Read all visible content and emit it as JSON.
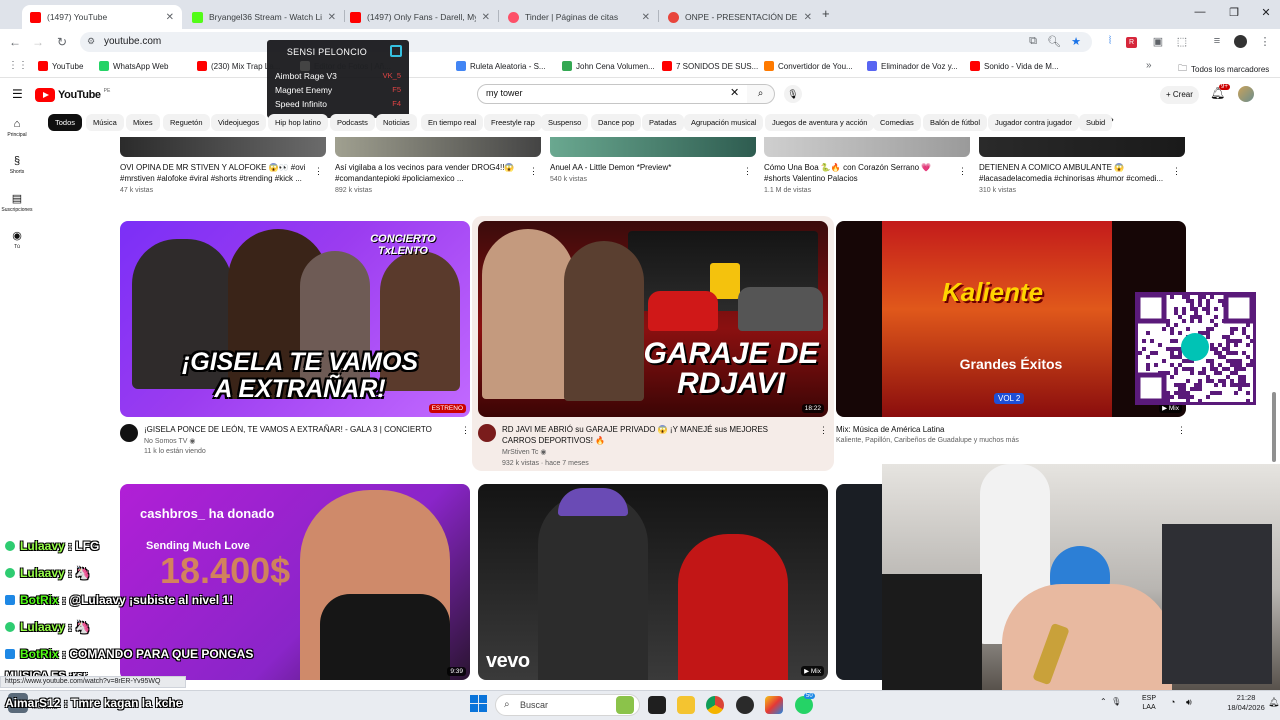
{
  "browser": {
    "tabs": [
      {
        "title": "(1497) YouTube",
        "active": true,
        "color": "#ff0000"
      },
      {
        "title": "Bryangel36 Stream - Watch Live",
        "active": false,
        "color": "#53fc18"
      },
      {
        "title": "(1497) Only Fans - Darell, Myke",
        "active": false,
        "color": "#ff0000"
      },
      {
        "title": "Tinder | Páginas de citas",
        "active": false,
        "color": "#fd5068"
      },
      {
        "title": "ONPE - PRESENTACIÓN DE RESU",
        "active": false,
        "color": "#e8453c"
      }
    ],
    "new_tab": "+",
    "url": "youtube.com",
    "bookmarks": [
      {
        "label": "YouTube",
        "color": "#ff0000"
      },
      {
        "label": "WhatsApp Web",
        "color": "#25d366"
      },
      {
        "label": "(230) Mix Trap La...",
        "color": "#ff0000"
      },
      {
        "label": "Editor de Fotos | Añ...",
        "color": "#444444"
      },
      {
        "label": "Ruleta Aleatoria - S...",
        "color": "#4285f4"
      },
      {
        "label": "John Cena Volumen...",
        "color": "#34a853"
      },
      {
        "label": "7 SONIDOS DE SUS...",
        "color": "#ff0000"
      },
      {
        "label": "Convertidor de You...",
        "color": "#ff7a00"
      },
      {
        "label": "Eliminador de Voz y...",
        "color": "#5865f2"
      },
      {
        "label": "Sonido - Vida de M...",
        "color": "#ff0000"
      }
    ],
    "all_bookmarks": "Todos los marcadores"
  },
  "youtube": {
    "logo_text": "YouTube",
    "logo_country": "PE",
    "search_value": "my tower",
    "create_label": "Crear",
    "notif_badge": "9+",
    "chips": [
      "Todos",
      "Música",
      "Mixes",
      "Reguetón",
      "Videojuegos",
      "Hip hop latino",
      "Podcasts",
      "Noticias",
      "En tiempo real",
      "Freestyle rap",
      "Suspenso",
      "Dance pop",
      "Patadas",
      "Agrupación musical",
      "Juegos de aventura y acción",
      "Comedias",
      "Balón de fútbol",
      "Jugador contra jugador",
      "Subid"
    ],
    "sidebar": [
      {
        "label": "Principal",
        "icon": "home-icon"
      },
      {
        "label": "Shorts",
        "icon": "shorts-icon"
      },
      {
        "label": "Suscripciones",
        "icon": "subscriptions-icon"
      },
      {
        "label": "Tú",
        "icon": "you-icon"
      }
    ],
    "top_row": [
      {
        "title": "OVI OPINA DE MR STIVEN Y ALOFOKE 😱👀 #ovi #mrstiven #alofoke #viral #shorts #trending #kick ...",
        "meta": "47 k vistas"
      },
      {
        "title": "Así vigilaba a los vecinos para vender DROG4!!😱 #comandantepioki #policiamexico ...",
        "meta": "892 k vistas"
      },
      {
        "title": "Anuel AA - Little Demon *Preview*",
        "meta": "540 k vistas"
      },
      {
        "title": "Cómo Una Boa 🐍🔥 con Corazón Serrano 💗 #shorts Valentino Palacios",
        "meta": "1.1 M de vistas"
      },
      {
        "title": "DETIENEN A COMICO AMBULANTE 😱 #lacasadelacomedia #chinorisas #humor #comedi...",
        "meta": "310 k vistas"
      }
    ],
    "row2": [
      {
        "title": "¡GISELA PONCE DE LEÓN, TE VAMOS A EXTRAÑAR! - GALA 3 | CONCIERTO TALENTO",
        "channel": "No Somos TV",
        "meta": "11 k lo están viendo",
        "thumb_caption": "¡GISELA TE VAMOS A EXTRAÑAR!",
        "thumb_badge": "CONCIERTO TxLENTO",
        "overlay": "ESTRENO"
      },
      {
        "title": "RD JAVI ME ABRIÓ su GARAJE PRIVADO 😱 ¡Y MANEJÉ sus MEJORES CARROS DEPORTIVOS! 🔥",
        "channel": "MrStiven Tc",
        "meta": "932 k vistas · hace 7 meses",
        "thumb_caption": "GARAJE DE RDJAVI",
        "duration": "18:22"
      },
      {
        "title": "Mix: Música de América Latina",
        "channel": "Kaliente, Papillón, Caribeños de Guadalupe y muchos más",
        "thumb_caption": "Kaliente",
        "thumb_sub": "Grandes Éxitos",
        "thumb_vol": "VOL 2",
        "overlay": "Mix"
      }
    ],
    "row3": [
      {
        "thumb_caption": "cashbros_ ha donado",
        "thumb_amount": "18.400$",
        "thumb_sub": "Sending Much Love",
        "duration": "9:39"
      },
      {
        "thumb_caption": "vevo",
        "overlay": "Mix"
      }
    ]
  },
  "overlays": {
    "cheat_menu": {
      "title": "SENSI PELONCIO",
      "items": [
        {
          "label": "Aimbot Rage V3",
          "key": "VK_5"
        },
        {
          "label": "Magnet Enemy",
          "key": "F5"
        },
        {
          "label": "Speed Infinito",
          "key": "F4"
        }
      ]
    },
    "chat": [
      {
        "user": "Lulaavy",
        "msg": "LFG",
        "ucolor": "#98ff4a",
        "icon": "#2ecc71"
      },
      {
        "user": "Lulaavy",
        "msg": "🦄",
        "ucolor": "#98ff4a",
        "icon": "#2ecc71"
      },
      {
        "user": "BotRix",
        "msg": "@Lulaavy ¡subiste al nivel 1!",
        "ucolor": "#53fc18",
        "icon": "#1e88e5"
      },
      {
        "user": "Lulaavy",
        "msg": "🦄",
        "ucolor": "#98ff4a",
        "icon": "#2ecc71"
      },
      {
        "user": "BotRix",
        "msg": "COMANDO PARA QUE PONGAS",
        "ucolor": "#53fc18",
        "icon": "#1e88e5"
      },
      {
        "user": "MUSICA ES :rsr",
        "msg": "",
        "ucolor": "#ffffff",
        "icon": ""
      },
      {
        "user": "AimarS12",
        "msg": "Tmre kagan la kche",
        "ucolor": "#ffffff",
        "icon": ""
      }
    ],
    "status_url": "https://www.youtube.com/watch?v=8rER-Yv95WQ"
  },
  "taskbar": {
    "search": "Buscar",
    "lang_top": "ESP",
    "lang_bottom": "LAA",
    "time": "21:28",
    "date": "18/04/2026",
    "chat_badge": "50",
    "weather_label": "Mañana"
  },
  "colors": {
    "youtube_red": "#ff0000",
    "chrome_tabbar": "#dfe3ea",
    "kick_green": "#53fc18"
  }
}
